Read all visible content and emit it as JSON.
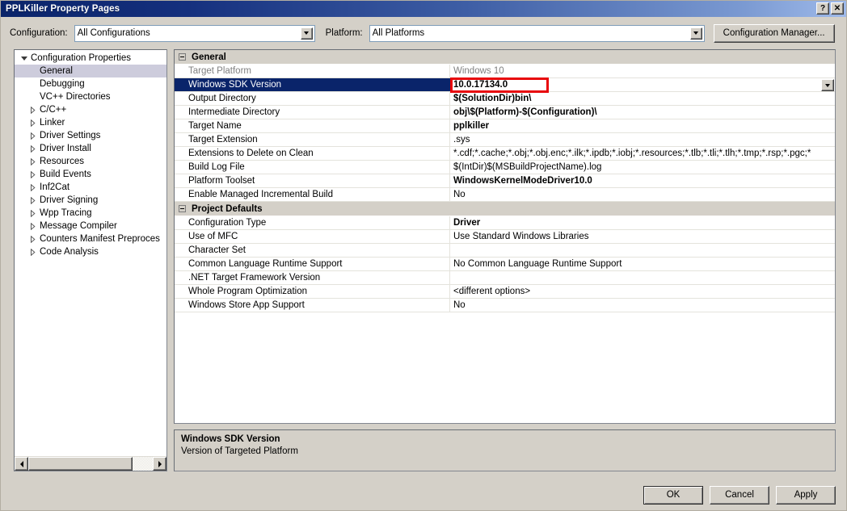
{
  "window": {
    "title": "PPLKiller Property Pages",
    "help_button": "?",
    "close_button": "✕"
  },
  "toolbar": {
    "configuration_label": "Configuration:",
    "configuration_value": "All Configurations",
    "platform_label": "Platform:",
    "platform_value": "All Platforms",
    "configuration_manager_label": "Configuration Manager..."
  },
  "tree": {
    "items": [
      {
        "label": "Configuration Properties",
        "level": 1,
        "twisty": "open",
        "selected": false
      },
      {
        "label": "General",
        "level": 2,
        "twisty": "none",
        "selected": true
      },
      {
        "label": "Debugging",
        "level": 2,
        "twisty": "none",
        "selected": false
      },
      {
        "label": "VC++ Directories",
        "level": 2,
        "twisty": "none",
        "selected": false
      },
      {
        "label": "C/C++",
        "level": 2,
        "twisty": "closed",
        "selected": false
      },
      {
        "label": "Linker",
        "level": 2,
        "twisty": "closed",
        "selected": false
      },
      {
        "label": "Driver Settings",
        "level": 2,
        "twisty": "closed",
        "selected": false
      },
      {
        "label": "Driver Install",
        "level": 2,
        "twisty": "closed",
        "selected": false
      },
      {
        "label": "Resources",
        "level": 2,
        "twisty": "closed",
        "selected": false
      },
      {
        "label": "Build Events",
        "level": 2,
        "twisty": "closed",
        "selected": false
      },
      {
        "label": "Inf2Cat",
        "level": 2,
        "twisty": "closed",
        "selected": false
      },
      {
        "label": "Driver Signing",
        "level": 2,
        "twisty": "closed",
        "selected": false
      },
      {
        "label": "Wpp Tracing",
        "level": 2,
        "twisty": "closed",
        "selected": false
      },
      {
        "label": "Message Compiler",
        "level": 2,
        "twisty": "closed",
        "selected": false
      },
      {
        "label": "Counters Manifest Preproces",
        "level": 2,
        "twisty": "closed",
        "selected": false
      },
      {
        "label": "Code Analysis",
        "level": 2,
        "twisty": "closed",
        "selected": false
      }
    ]
  },
  "grid": {
    "categories": [
      {
        "name": "General",
        "rows": [
          {
            "name": "Target Platform",
            "value": "Windows 10",
            "bold": false,
            "inherited": true,
            "selected": false,
            "dropdown": false
          },
          {
            "name": "Windows SDK Version",
            "value": "10.0.17134.0",
            "bold": true,
            "inherited": false,
            "selected": true,
            "dropdown": true,
            "highlighted": true
          },
          {
            "name": "Output Directory",
            "value": "$(SolutionDir)bin\\",
            "bold": true,
            "inherited": false,
            "selected": false,
            "dropdown": false
          },
          {
            "name": "Intermediate Directory",
            "value": "obj\\$(Platform)-$(Configuration)\\",
            "bold": true,
            "inherited": false,
            "selected": false,
            "dropdown": false
          },
          {
            "name": "Target Name",
            "value": "pplkiller",
            "bold": true,
            "inherited": false,
            "selected": false,
            "dropdown": false
          },
          {
            "name": "Target Extension",
            "value": ".sys",
            "bold": false,
            "inherited": false,
            "selected": false,
            "dropdown": false
          },
          {
            "name": "Extensions to Delete on Clean",
            "value": "*.cdf;*.cache;*.obj;*.obj.enc;*.ilk;*.ipdb;*.iobj;*.resources;*.tlb;*.tli;*.tlh;*.tmp;*.rsp;*.pgc;*",
            "bold": false,
            "inherited": false,
            "selected": false,
            "dropdown": false
          },
          {
            "name": "Build Log File",
            "value": "$(IntDir)$(MSBuildProjectName).log",
            "bold": false,
            "inherited": false,
            "selected": false,
            "dropdown": false
          },
          {
            "name": "Platform Toolset",
            "value": "WindowsKernelModeDriver10.0",
            "bold": true,
            "inherited": false,
            "selected": false,
            "dropdown": false
          },
          {
            "name": "Enable Managed Incremental Build",
            "value": "No",
            "bold": false,
            "inherited": false,
            "selected": false,
            "dropdown": false
          }
        ]
      },
      {
        "name": "Project Defaults",
        "rows": [
          {
            "name": "Configuration Type",
            "value": "Driver",
            "bold": true,
            "inherited": false,
            "selected": false,
            "dropdown": false
          },
          {
            "name": "Use of MFC",
            "value": "Use Standard Windows Libraries",
            "bold": false,
            "inherited": false,
            "selected": false,
            "dropdown": false
          },
          {
            "name": "Character Set",
            "value": "",
            "bold": false,
            "inherited": false,
            "selected": false,
            "dropdown": false
          },
          {
            "name": "Common Language Runtime Support",
            "value": "No Common Language Runtime Support",
            "bold": false,
            "inherited": false,
            "selected": false,
            "dropdown": false
          },
          {
            "name": ".NET Target Framework Version",
            "value": "",
            "bold": false,
            "inherited": false,
            "selected": false,
            "dropdown": false
          },
          {
            "name": "Whole Program Optimization",
            "value": "<different options>",
            "bold": false,
            "inherited": false,
            "selected": false,
            "dropdown": false
          },
          {
            "name": "Windows Store App Support",
            "value": "No",
            "bold": false,
            "inherited": false,
            "selected": false,
            "dropdown": false
          }
        ]
      }
    ]
  },
  "description": {
    "title": "Windows SDK Version",
    "text": "Version of Targeted Platform"
  },
  "footer": {
    "ok_label": "OK",
    "cancel_label": "Cancel",
    "apply_label": "Apply"
  },
  "colors": {
    "title_bar_start": "#0a246a",
    "title_bar_end": "#9fbaea",
    "dialog_face": "#d4d0c8",
    "selection": "#0a246a",
    "tree_selection": "#cdccdc",
    "annotation_red": "#e8060a"
  }
}
